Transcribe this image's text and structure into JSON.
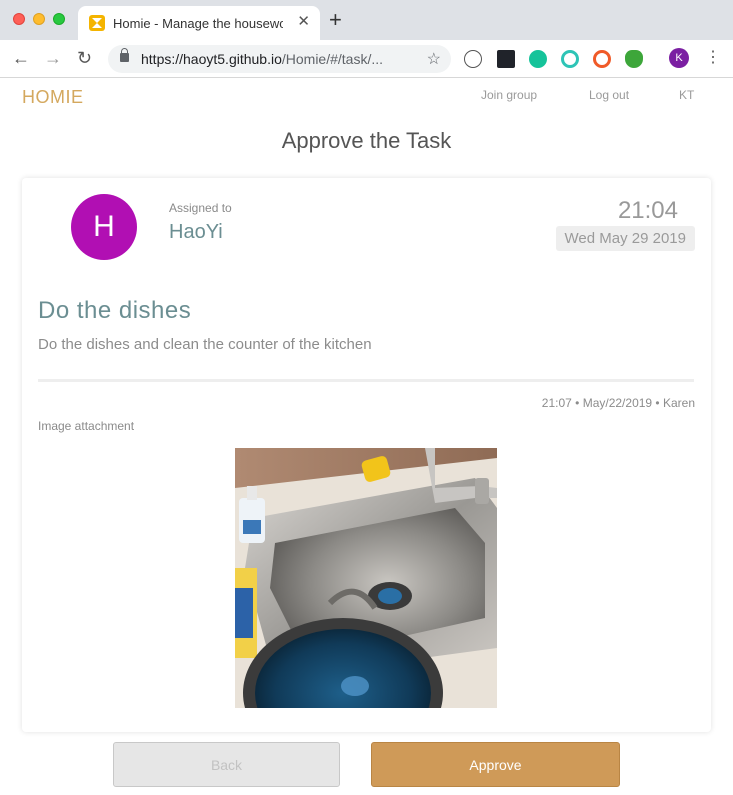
{
  "browser": {
    "tab_title": "Homie - Manage the housewor",
    "url_host": "https://haoyt5.github.io",
    "url_path": "/Homie/#/task/...",
    "profile_initial": "K"
  },
  "header": {
    "brand": "HOMIE",
    "join_group": "Join group",
    "log_out": "Log out",
    "user": "KT"
  },
  "page": {
    "title": "Approve the Task"
  },
  "task": {
    "avatar_initial": "H",
    "assigned_label": "Assigned to",
    "assignee": "HaoYi",
    "due_time": "21:04",
    "due_date": "Wed May 29 2019",
    "title": "Do the dishes",
    "description": "Do the dishes and clean the counter of the kitchen",
    "meta_time": "21:07",
    "meta_date": "May/22/2019",
    "meta_user": "Karen",
    "attachment_label": "Image attachment"
  },
  "actions": {
    "back": "Back",
    "approve": "Approve"
  },
  "colors": {
    "brand": "#d4a85e",
    "accent_text": "#6b8e92",
    "avatar": "#b10fb3",
    "approve": "#cf9a58"
  }
}
